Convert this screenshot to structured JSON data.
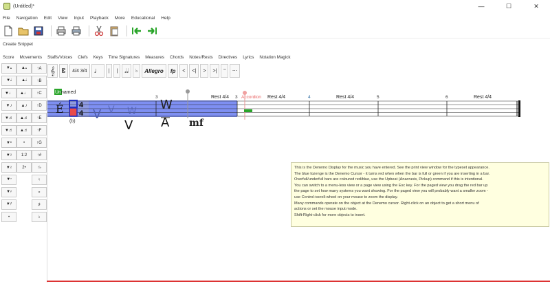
{
  "window": {
    "title": "(Untitled)*",
    "minimize": "—",
    "maximize": "☐",
    "close": "✕"
  },
  "menubar": [
    "File",
    "Navigation",
    "Edit",
    "View",
    "Input",
    "Playback",
    "More",
    "Educational",
    "Help"
  ],
  "toolbar": {
    "icons": [
      "new-file-icon",
      "open-folder-icon",
      "save-icon",
      "print-icon",
      "print-preview-icon",
      "cut-icon",
      "paste-icon",
      "first-page-icon",
      "last-page-icon"
    ]
  },
  "snippet_label": "Create Snippet",
  "secondary_menu": [
    "Score",
    "Movements",
    "Staffs/Voices",
    "Clefs",
    "Keys",
    "Time Signatures",
    "Measures",
    "Chords",
    "Notes/Rests",
    "Directives",
    "Lyrics",
    "Notation Magick"
  ],
  "palette": {
    "rows": [
      [
        "▼𝅝",
        "▲𝅝",
        "↑A"
      ],
      [
        "▼𝅗𝅥",
        "▲𝅗𝅥",
        "↑B"
      ],
      [
        "▼♩",
        "▲♩",
        "↑C"
      ],
      [
        "▼♪",
        "▲♪",
        "↑D"
      ],
      [
        "▼♬",
        "▲♬",
        "↑E"
      ],
      [
        "▼♬",
        "▲♬",
        "↑F"
      ],
      [
        "▼•",
        "•",
        "↑G"
      ],
      [
        "▼≀",
        "1:2",
        "↑#"
      ],
      [
        "▼≀",
        "2•",
        "↑♭"
      ],
      [
        "▼𝄾",
        "",
        "♮"
      ],
      [
        "▼𝄿",
        "",
        "𝄪"
      ],
      [
        "▼𝅀",
        "",
        "♯"
      ],
      [
        "•",
        "",
        "♭"
      ]
    ]
  },
  "rhythm_bar": [
    "𝄞",
    "𝄡",
    "4/4 3/4",
    "♩",
    "|",
    "|",
    "𝅗𝅥𝅗𝅥",
    "♭",
    "Allegro",
    "fp",
    "<",
    "<|",
    ">",
    ">|",
    "\"",
    "⋯"
  ],
  "score": {
    "staff_name": "Unnamed",
    "staff_name_highlight": "Un",
    "time_signature_top": "4",
    "time_signature_bottom": "4",
    "clef": "É",
    "measure_numbers": [
      "3",
      "4",
      "5",
      "6"
    ],
    "rests": [
      "Rest 4/4",
      "Rest 4/4",
      "Rest 4/4",
      "Rest 4/4"
    ],
    "directive": "Accordion",
    "dynamic": "mf",
    "letters": [
      "W",
      "V",
      "A"
    ],
    "small_label": "(b)"
  },
  "tooltip": [
    "This is the Denemo Display for the music you have entered. See the print view window for the typeset appearance.",
    "The blue lozenge is the Denemo Cursor - it turns red when when the bar is full or green if you are inserting in a bar.",
    "Overfull/underfull bars are coloured red/blue, use the Upbeat (Anacrusis, Pickup) command if this is intentional.",
    "You can switch to a menu-less view or a page view using the Esc key. For the paged view you drag the red bar up",
    "the page to set how many systems you want showing. For the paged view you will probably want a smaller zoom -",
    "use Control+scroll-wheel on your mouse to zoom the display.",
    "Many commands operate on the object at the Denemo cursor. Right-click on an object to get a short menu of",
    "actions or set the mouse input mode.",
    "Shift-Right-click for more objects to insert."
  ],
  "colors": {
    "selection": "#7e8ff2",
    "cursor_fill": "#e84b4b",
    "accent_green": "#2aa52a",
    "tooltip_bg": "#ffffe0",
    "redline": "#dd3333"
  }
}
